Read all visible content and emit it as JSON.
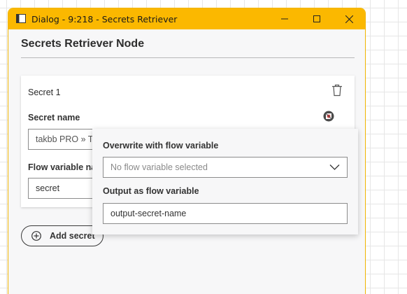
{
  "window": {
    "title": "Dialog - 9:218 - Secrets Retriever",
    "accent_color": "#fbb800",
    "icons": {
      "app": "window-icon",
      "minimize": "minimize-icon",
      "maximize": "maximize-icon",
      "close": "close-icon"
    }
  },
  "dialog": {
    "heading": "Secrets Retriever Node"
  },
  "secret_card": {
    "title": "Secret 1",
    "secret_name_label": "Secret name",
    "secret_name_value": "takbb PRO » Te",
    "flow_variable_label": "Flow variable na",
    "flow_variable_value": "secret",
    "icons": {
      "delete": "trash-icon",
      "flow_variable": "flow-variable-icon"
    }
  },
  "add_secret": {
    "label": "Add secret",
    "icon": "plus-circle-icon"
  },
  "flow_variable_popover": {
    "overwrite_label": "Overwrite with flow variable",
    "overwrite_placeholder": "No flow variable selected",
    "output_label": "Output as flow variable",
    "output_value": "output-secret-name",
    "icons": {
      "dropdown": "chevron-down-icon"
    }
  }
}
